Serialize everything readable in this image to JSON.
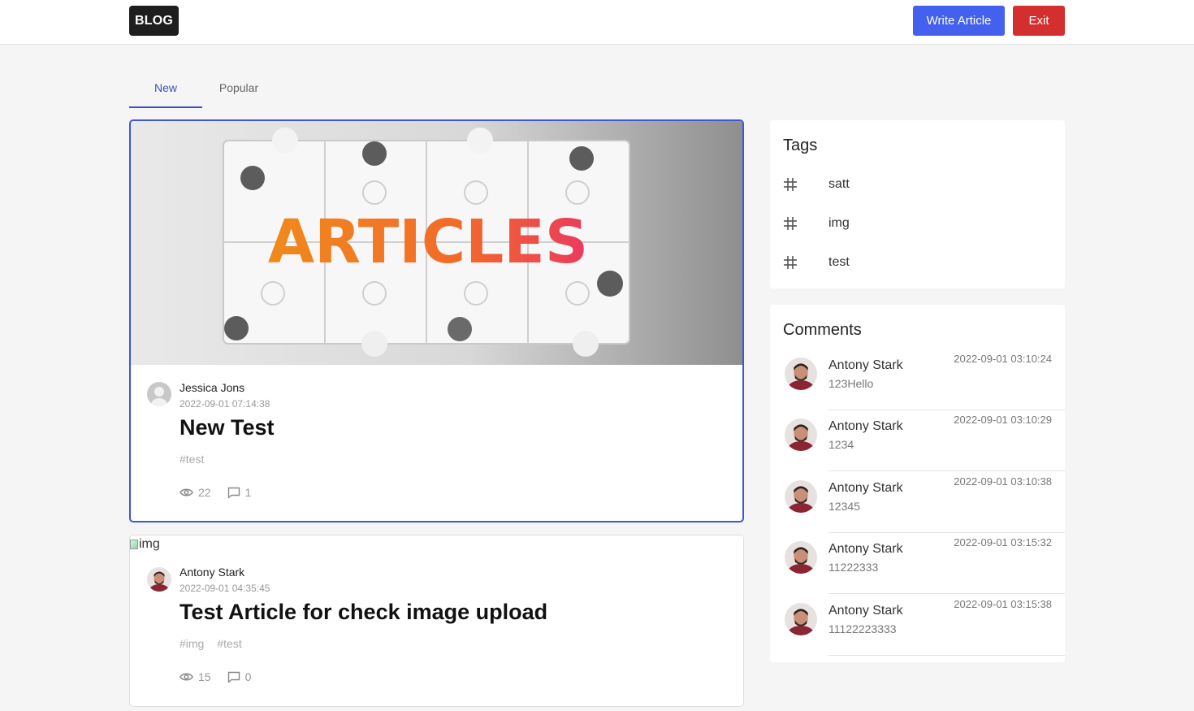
{
  "header": {
    "logo": "BLOG",
    "write_label": "Write Article",
    "exit_label": "Exit",
    "write_color": "#4361ee",
    "exit_color": "#d32f2f"
  },
  "tabs": [
    {
      "label": "New",
      "active": true
    },
    {
      "label": "Popular",
      "active": false
    }
  ],
  "posts": [
    {
      "hero_text": "ARTICLES",
      "author": "Jessica Jons",
      "date": "2022-09-01 07:14:38",
      "title": "New Test",
      "tags": [
        "#test"
      ],
      "views": "22",
      "comments": "1",
      "avatar": "default-avatar-icon"
    },
    {
      "image_alt": "img",
      "author": "Antony Stark",
      "date": "2022-09-01 04:35:45",
      "title": "Test Article for check image upload",
      "tags": [
        "#img",
        "#test"
      ],
      "views": "15",
      "comments": "0",
      "avatar": "user-photo"
    }
  ],
  "sidebar": {
    "tags_title": "Tags",
    "tags": [
      "satt",
      "img",
      "test"
    ],
    "comments_title": "Comments",
    "comments": [
      {
        "name": "Antony Stark",
        "text": "123Hello",
        "date": "2022-09-01 03:10:24"
      },
      {
        "name": "Antony Stark",
        "text": "1234",
        "date": "2022-09-01 03:10:29"
      },
      {
        "name": "Antony Stark",
        "text": "12345",
        "date": "2022-09-01 03:10:38"
      },
      {
        "name": "Antony Stark",
        "text": "11222333",
        "date": "2022-09-01 03:15:32"
      },
      {
        "name": "Antony Stark",
        "text": "11122223333",
        "date": "2022-09-01 03:15:38"
      }
    ]
  }
}
